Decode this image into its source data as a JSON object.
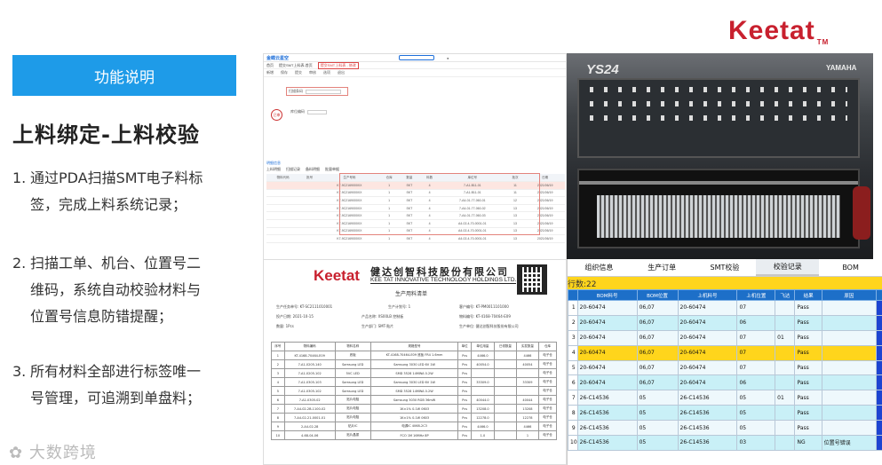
{
  "brand": {
    "name": "Keetat",
    "tm": "TM"
  },
  "sidebar": {
    "section_label": "功能说明",
    "title": "上料绑定-上料校验",
    "bullets": [
      {
        "num": "1.",
        "line1": "通过PDA扫描SMT电子料标",
        "line2": "签，完成上料系统记录；"
      },
      {
        "num": "2.",
        "line1": "扫描工单、机台、位置号二",
        "line2": "维码，系统自动校验材料与",
        "line3": "位置号信息防错提醒；"
      },
      {
        "num": "3.",
        "line1": "所有材料全部进行标签唯一",
        "line2": "号管理，可追溯到单盘料；"
      }
    ]
  },
  "watermark": "大数跨境",
  "app_screen": {
    "logo": "金蝶云星空",
    "tabs": [
      "首页",
      "提交SMT上料表-首页",
      "提交SMT上料表 - 修改"
    ],
    "toolbar": [
      "新增",
      "保存",
      "提交",
      "审核",
      "选项",
      "退出"
    ],
    "scan_label": "扫描条码",
    "loc_label": "库位编码",
    "stamp": "已审",
    "detail_label": "明细信息",
    "subtabs": [
      "上料明细",
      "扫描记录",
      "备料明细",
      "批量单据"
    ],
    "grid_headers": [
      "物料代码",
      "批号",
      "生产号码",
      "仓库",
      "数量",
      "料数",
      "库位号",
      "批次",
      "日期"
    ],
    "grid_rows": [
      [
        "",
        "",
        "K7-9C2169000XX",
        "1",
        "SKT",
        "4",
        "7-A1-B11-01",
        "11",
        "2021/06/19"
      ],
      [
        "",
        "",
        "K7-9C2169000XX",
        "1",
        "SKT",
        "4",
        "7-A1-B11-01",
        "11",
        "2021/06/19"
      ],
      [
        "",
        "",
        "K7-9C2169000XX",
        "1",
        "SKT",
        "4",
        "7-A4-01-77-060-01",
        "12",
        "2021/06/19"
      ],
      [
        "",
        "",
        "K7-9C2169000XX",
        "1",
        "SKT",
        "4",
        "7-A4-01-77-060-02",
        "13",
        "2021/06/19"
      ],
      [
        "",
        "",
        "K7-9C2169000XX",
        "1",
        "SKT",
        "4",
        "7-A4-01-77-060-03",
        "13",
        "2021/06/19"
      ],
      [
        "",
        "",
        "K7-9C2169000XX",
        "1",
        "SKT",
        "4",
        "A4-02-4-70-0001-01",
        "13",
        "2021/06/19"
      ],
      [
        "",
        "",
        "K7-9C2169000XX",
        "1",
        "SKT",
        "4",
        "A4-02-4-70-0001-01",
        "13",
        "2021/06/19"
      ],
      [
        "",
        "",
        "K7-9C2169000XX",
        "1",
        "SKT",
        "4",
        "A4-02-4-70-0001-01",
        "13",
        "2021/06/19"
      ]
    ]
  },
  "document": {
    "logo": "Keetat",
    "company_cn": "健达创智科技股份有限公司",
    "company_en": "KEE TAT INNOVATIVE TECHNOLOGY HOLDINGS LTD.",
    "title": "生产用料清单",
    "meta": [
      "生产任务单号: KT-SC2111010001",
      "生产计划号: 1",
      "客户编号: KT-PM0011101000",
      "投产日期: 2021-10-15",
      "产品名称: XS00LB 控制板",
      "物料编号: KT-4168-70464-E09",
      "数量: 1Pcs",
      "生产部门: SMT-贴片",
      "生产单位: 健达创智科技股份有限公司"
    ],
    "table_headers": [
      "序号",
      "物料编码",
      "物料名称",
      "规格型号",
      "单位",
      "单位用量",
      "已领数量",
      "实发数量",
      "仓库"
    ],
    "table_rows": [
      [
        "1",
        "KT-4168-70464-E09",
        "底板",
        "KT-4168-70464-E09 底板 FR4 1.6mm",
        "Pcs",
        "4466.0",
        "",
        "4466",
        "电子仓"
      ],
      [
        "2",
        "7-A1-0205-140",
        "Samsung LED",
        "Samsung 3030 LED 6V 1W",
        "Pcs",
        "40054.0",
        "",
        "40054",
        "电子仓"
      ],
      [
        "3",
        "7-A1-0205-102",
        "5VC LED",
        "SMD 3528 14MWA 0.2W",
        "Pcs",
        "",
        "",
        "",
        "电子仓"
      ],
      [
        "4",
        "7-A1-0305-103",
        "Samsung LED",
        "Samsung 3030 LED 6V 1W",
        "Pcs",
        "33309.0",
        "",
        "33309",
        "电子仓"
      ],
      [
        "5",
        "7-A1-0305-102",
        "Samsung LED",
        "SMD 3528 14MWA 0.2W",
        "Pcs",
        "",
        "",
        "",
        "电子仓"
      ],
      [
        "6",
        "7-A1-0305-02",
        "贴片电阻",
        "Samsung 3030 RGB 36mW",
        "Pcs",
        "40044.0",
        "",
        "40044",
        "电子仓"
      ],
      [
        "7",
        "7-A4-02-2B-1100-02",
        "贴片电阻",
        "1K±1% 0.1W 0603",
        "Pcs",
        "13208.0",
        "",
        "13208",
        "电子仓"
      ],
      [
        "8",
        "7-A4-02-21-0001-01",
        "贴片电阻",
        "1K±1% 0.1W 0603",
        "Pcs",
        "12278.0",
        "",
        "12278",
        "电子仓"
      ],
      [
        "9",
        "2-A4-02-28",
        "贴片IC",
        "电源IC 4068-2C3",
        "Pcs",
        "4466.0",
        "",
        "4466",
        "电子仓"
      ],
      [
        "10",
        "4-68-04-06",
        "贴片晶振",
        "FCO 1M 16MHz 8P",
        "Pcs",
        "1.0",
        "",
        "1",
        "电子仓"
      ]
    ]
  },
  "photo": {
    "model": "YS24",
    "maker": "YAMAHA"
  },
  "verify": {
    "tabs": [
      "组织信息",
      "生产订单",
      "SMT校验",
      "校验记录",
      "BOM"
    ],
    "active_tab": 3,
    "count_label": "行数:22",
    "headers": [
      "BOM料号",
      "BOM位置",
      "上机料号",
      "上机位置",
      "飞达",
      "结果",
      "原因"
    ],
    "rows": [
      [
        "1",
        "20-60474",
        "06,07",
        "20-60474",
        "07",
        "",
        "Pass",
        ""
      ],
      [
        "2",
        "20-60474",
        "06,07",
        "20-60474",
        "06",
        "",
        "Pass",
        ""
      ],
      [
        "3",
        "20-60474",
        "06,07",
        "20-60474",
        "07",
        "01",
        "Pass",
        ""
      ],
      [
        "4",
        "20-60474",
        "06,07",
        "20-60474",
        "07",
        "",
        "Pass",
        ""
      ],
      [
        "5",
        "20-60474",
        "06,07",
        "20-60474",
        "07",
        "",
        "Pass",
        ""
      ],
      [
        "6",
        "20-60474",
        "06,07",
        "20-60474",
        "06",
        "",
        "Pass",
        ""
      ],
      [
        "7",
        "26-C14536",
        "05",
        "26-C14536",
        "05",
        "01",
        "Pass",
        ""
      ],
      [
        "8",
        "26-C14536",
        "05",
        "26-C14536",
        "05",
        "",
        "Pass",
        ""
      ],
      [
        "9",
        "26-C14536",
        "05",
        "26-C14536",
        "05",
        "",
        "Pass",
        ""
      ],
      [
        "10",
        "26-C14536",
        "05",
        "26-C14536",
        "03",
        "",
        "NG",
        "位置号错误"
      ]
    ],
    "selected_row": 3
  }
}
